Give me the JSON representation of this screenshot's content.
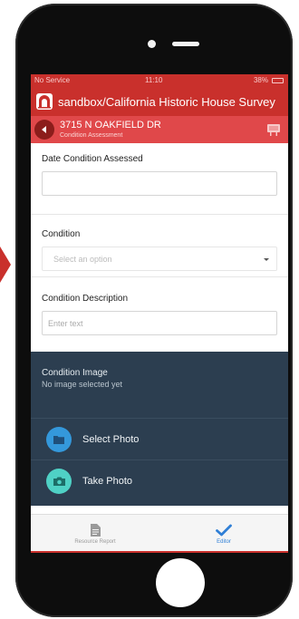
{
  "status_bar": {
    "carrier": "No Service",
    "time": "11:10",
    "battery": "38%"
  },
  "header": {
    "title": "sandbox/California Historic House Survey"
  },
  "record": {
    "title": "3715 N OAKFIELD DR",
    "subtitle": "Condition Assessment"
  },
  "form": {
    "date_label": "Date Condition Assessed",
    "date_value": "",
    "condition_label": "Condition",
    "condition_placeholder": "Select an option",
    "description_label": "Condition Description",
    "description_placeholder": "Enter text"
  },
  "image_section": {
    "title": "Condition Image",
    "status": "No image selected yet",
    "select_photo_label": "Select Photo",
    "take_photo_label": "Take Photo"
  },
  "tabs": [
    {
      "label": "Resource Report",
      "icon": "document-icon",
      "active": false
    },
    {
      "label": "Editor",
      "icon": "checkmark-icon",
      "active": true
    }
  ],
  "colors": {
    "brand_red": "#c9302c",
    "record_bar_red": "#e0484a",
    "panel_navy": "#2c3e50",
    "select_photo_blue": "#3498db",
    "take_photo_teal": "#4fd1c5",
    "active_tab_blue": "#2f7fd6"
  }
}
